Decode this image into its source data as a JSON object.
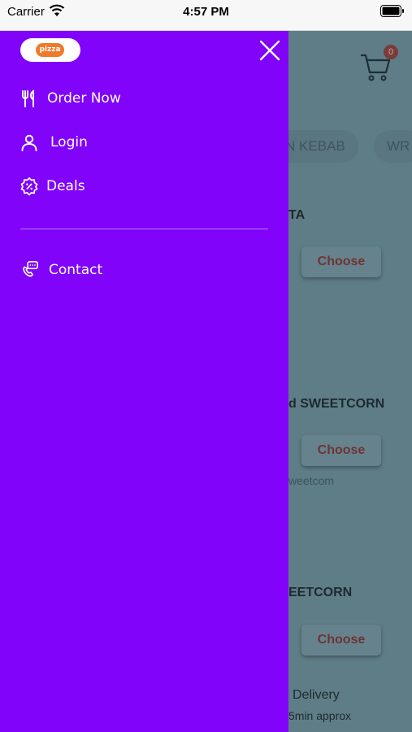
{
  "status_bar": {
    "carrier": "Carrier",
    "time": "4:57 PM"
  },
  "drawer": {
    "logo_text": "pizza",
    "menu_items": [
      {
        "label": "Order Now",
        "icon": "cutlery-icon"
      },
      {
        "label": "Login",
        "icon": "user-icon"
      },
      {
        "label": "Deals",
        "icon": "discount-badge-icon"
      }
    ],
    "secondary_items": [
      {
        "label": "Contact",
        "icon": "phone-chat-icon"
      }
    ]
  },
  "background": {
    "cart_count": "0",
    "tabs": [
      "N KEBAB",
      "WR"
    ],
    "items": [
      {
        "title": "TA",
        "button": "Choose",
        "desc": ""
      },
      {
        "title": "d SWEETCORN",
        "button": "Choose",
        "desc": "weetcom"
      },
      {
        "title": "EETCORN",
        "button": "Choose",
        "desc": ""
      }
    ],
    "delivery_label": "Delivery",
    "delivery_time": "5min approx"
  },
  "colors": {
    "drawer": "#8103f9",
    "overlay": "#5f7d87",
    "text": "#ffffff"
  }
}
